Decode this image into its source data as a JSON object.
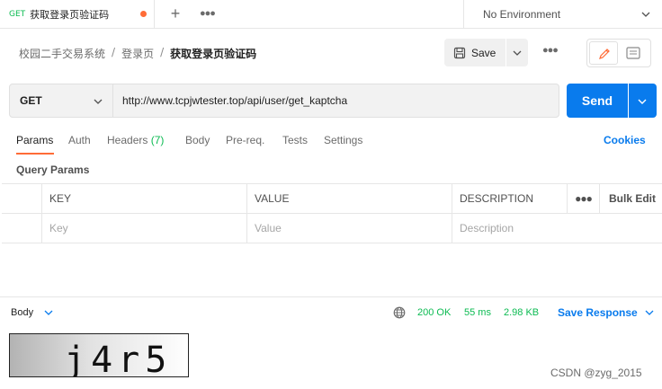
{
  "tab": {
    "method": "GET",
    "name": "获取登录页验证码"
  },
  "environment": {
    "label": "No Environment"
  },
  "breadcrumb": {
    "items": [
      "校园二手交易系统",
      "登录页"
    ],
    "current": "获取登录页验证码",
    "separator": "/"
  },
  "toolbar": {
    "save_label": "Save"
  },
  "request": {
    "method": "GET",
    "url": "http://www.tcpjwtester.top/api/user/get_kaptcha",
    "send_label": "Send"
  },
  "req_tabs": [
    {
      "label": "Params",
      "active": true
    },
    {
      "label": "Auth"
    },
    {
      "label": "Headers",
      "count": "(7)"
    },
    {
      "label": "Body"
    },
    {
      "label": "Pre-req."
    },
    {
      "label": "Tests"
    },
    {
      "label": "Settings"
    }
  ],
  "cookies_label": "Cookies",
  "query_params": {
    "title": "Query Params",
    "columns": [
      "KEY",
      "VALUE",
      "DESCRIPTION"
    ],
    "bulk_edit": "Bulk Edit",
    "placeholders": {
      "key": "Key",
      "value": "Value",
      "description": "Description"
    }
  },
  "response": {
    "body_label": "Body",
    "status": "200 OK",
    "time": "55 ms",
    "size": "2.98 KB",
    "save_label": "Save Response"
  },
  "captcha_text": "j4r5",
  "watermark": "CSDN @zyg_2015",
  "colors": {
    "accent": "#097bed",
    "orange": "#ff6c37",
    "success": "#0cbb52"
  }
}
